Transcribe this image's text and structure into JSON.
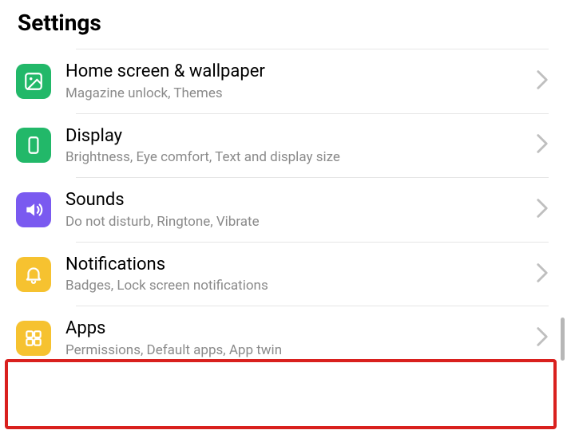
{
  "page": {
    "title": "Settings"
  },
  "items": [
    {
      "id": "home-screen-wallpaper",
      "title": "Home screen & wallpaper",
      "subtitle": "Magazine unlock, Themes",
      "icon": "wallpaper-icon",
      "icon_color": "#22b869"
    },
    {
      "id": "display",
      "title": "Display",
      "subtitle": "Brightness, Eye comfort, Text and display size",
      "icon": "display-icon",
      "icon_color": "#22b869"
    },
    {
      "id": "sounds",
      "title": "Sounds",
      "subtitle": "Do not disturb, Ringtone, Vibrate",
      "icon": "sound-icon",
      "icon_color": "#7a5af0"
    },
    {
      "id": "notifications",
      "title": "Notifications",
      "subtitle": "Badges, Lock screen notifications",
      "icon": "bell-icon",
      "icon_color": "#f6c230"
    },
    {
      "id": "apps",
      "title": "Apps",
      "subtitle": "Permissions, Default apps, App twin",
      "icon": "apps-icon",
      "icon_color": "#f6c230",
      "highlighted": true
    }
  ]
}
